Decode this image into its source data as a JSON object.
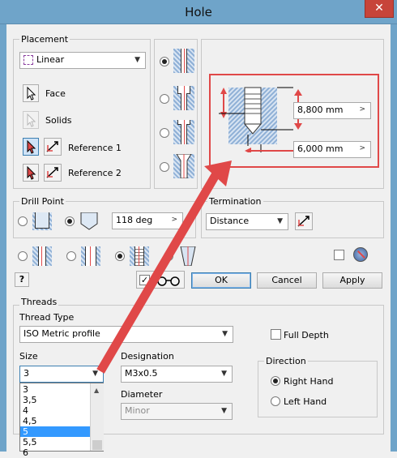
{
  "window": {
    "title": "Hole",
    "close_glyph": "✕"
  },
  "placement": {
    "group_label": "Placement",
    "type_value": "Linear",
    "face_label": "Face",
    "solids_label": "Solids",
    "reference1_label": "Reference 1",
    "reference2_label": "Reference 2"
  },
  "preview": {
    "depth_value": "8,800 mm",
    "diameter_value": "6,000 mm",
    "more_glyph": ">"
  },
  "drill_point": {
    "group_label": "Drill Point",
    "angle_value": "118 deg",
    "more_glyph": ">"
  },
  "termination": {
    "group_label": "Termination",
    "value": "Distance"
  },
  "buttons": {
    "help_glyph": "?",
    "ok": "OK",
    "cancel": "Cancel",
    "apply": "Apply"
  },
  "threads": {
    "group_label": "Threads",
    "thread_type_label": "Thread Type",
    "thread_type_value": "ISO Metric profile",
    "full_depth_label": "Full Depth",
    "size_label": "Size",
    "size_value": "3",
    "designation_label": "Designation",
    "designation_value": "M3x0.5",
    "diameter_label": "Diameter",
    "diameter_value": "Minor",
    "direction_label": "Direction",
    "right_hand_label": "Right Hand",
    "left_hand_label": "Left Hand",
    "size_options": [
      "3",
      "3,5",
      "4",
      "4,5",
      "5",
      "5,5",
      "6"
    ],
    "selected_size_option": "5"
  },
  "colors": {
    "accent_red": "#e04848",
    "hatch_blue": "#8fb0d6",
    "title_bar": "#6fa4c9",
    "selection": "#3399ff"
  }
}
